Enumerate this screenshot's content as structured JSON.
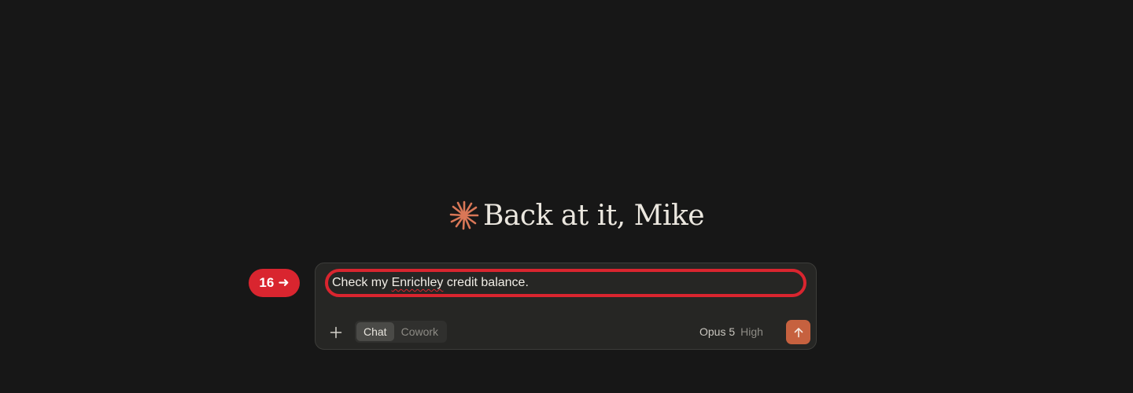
{
  "greeting": {
    "text": "Back at it, Mike",
    "icon": "spark-icon",
    "icon_color": "#d97757"
  },
  "composer": {
    "prompt": {
      "before": "Check my ",
      "misspelled": "Enrichley",
      "after": " credit balance."
    },
    "add_icon": "plus-icon",
    "modes": [
      {
        "label": "Chat",
        "active": true
      },
      {
        "label": "Cowork",
        "active": false
      }
    ],
    "model": "Opus 5",
    "effort": "High",
    "send_icon": "arrow-up-icon",
    "send_color": "#c6613f"
  },
  "annotation": {
    "step": "16",
    "arrow": "➜",
    "color": "#d9252f"
  }
}
